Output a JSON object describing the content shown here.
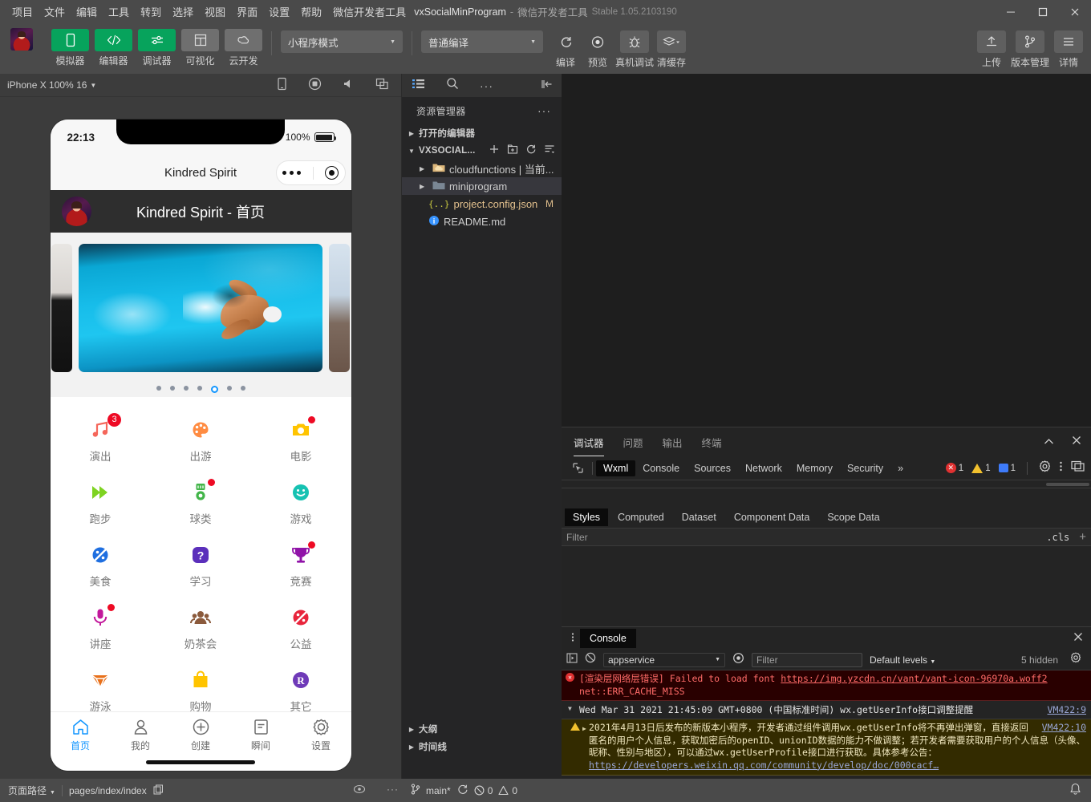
{
  "window": {
    "menus": [
      "项目",
      "文件",
      "编辑",
      "工具",
      "转到",
      "选择",
      "视图",
      "界面",
      "设置",
      "帮助",
      "微信开发者工具"
    ],
    "title_main": "vxSocialMinProgram",
    "title_sep": "-",
    "title_sub": "微信开发者工具",
    "title_version": "Stable 1.05.2103190",
    "minimize": "—",
    "maximize": "☐",
    "close": "✕"
  },
  "toolbar": {
    "tools": [
      {
        "label": "模拟器",
        "icon": "phone-icon",
        "style": "green"
      },
      {
        "label": "编辑器",
        "icon": "code-icon",
        "style": "green"
      },
      {
        "label": "调试器",
        "icon": "sliders-icon",
        "style": "green"
      },
      {
        "label": "可视化",
        "icon": "layout-icon",
        "style": "grey"
      },
      {
        "label": "云开发",
        "icon": "cloud-icon",
        "style": "grey"
      }
    ],
    "mode_select": "小程序模式",
    "compile_select": "普通编译",
    "actions": [
      {
        "label": "编译",
        "icon": "refresh-icon"
      },
      {
        "label": "预览",
        "icon": "eye-icon"
      },
      {
        "label": "真机调试",
        "icon": "bug-icon"
      },
      {
        "label": "清缓存",
        "icon": "layers-icon"
      }
    ],
    "right_actions": [
      {
        "label": "上传",
        "icon": "upload-icon"
      },
      {
        "label": "版本管理",
        "icon": "branch-icon"
      },
      {
        "label": "详情",
        "icon": "menu-icon"
      }
    ]
  },
  "simulator": {
    "device": "iPhone X 100% 16",
    "toolbar_icons": [
      "device-icon",
      "record-icon",
      "volume-icon",
      "windows-icon"
    ],
    "status_bar": {
      "time": "22:13",
      "battery_text": "100%"
    },
    "nav": {
      "title": "Kindred Spirit"
    },
    "page_header": {
      "title": "Kindred Spirit - 首页"
    },
    "carousel": {
      "dots_total": 7,
      "active_index": 4
    },
    "grid": [
      {
        "label": "演出",
        "icon": "music-icon",
        "color": "#f5665a",
        "badge": "3"
      },
      {
        "label": "出游",
        "icon": "palette-icon",
        "color": "#ff8c42",
        "badge": ""
      },
      {
        "label": "电影",
        "icon": "camera-icon",
        "color": "#ffc400",
        "badge": "dot"
      },
      {
        "label": "跑步",
        "icon": "fast-forward-icon",
        "color": "#7ed321",
        "badge": ""
      },
      {
        "label": "球类",
        "icon": "medal-icon",
        "color": "#42b549",
        "badge": "dot"
      },
      {
        "label": "游戏",
        "icon": "smile-icon",
        "color": "#16c2b2",
        "badge": ""
      },
      {
        "label": "美食",
        "icon": "planet-icon",
        "color": "#1f6fe0",
        "badge": ""
      },
      {
        "label": "学习",
        "icon": "question-icon",
        "color": "#5b2fbb",
        "badge": ""
      },
      {
        "label": "竞赛",
        "icon": "trophy-icon",
        "color": "#9013a8",
        "badge": "dot"
      },
      {
        "label": "讲座",
        "icon": "microphone-icon",
        "color": "#c2189b",
        "badge": "dot"
      },
      {
        "label": "奶茶会",
        "icon": "group-icon",
        "color": "#8b5a3c",
        "badge": ""
      },
      {
        "label": "公益",
        "icon": "planet-icon",
        "color": "#e8253c",
        "badge": ""
      },
      {
        "label": "游泳",
        "icon": "diamond-icon",
        "color": "#e8701a",
        "badge": ""
      },
      {
        "label": "购物",
        "icon": "bag-icon",
        "color": "#ffc400",
        "badge": ""
      },
      {
        "label": "其它",
        "icon": "registered-icon",
        "color": "#6f3ab8",
        "badge": ""
      }
    ],
    "tabbar": [
      {
        "label": "首页",
        "icon": "home-icon",
        "active": true
      },
      {
        "label": "我的",
        "icon": "user-icon",
        "active": false
      },
      {
        "label": "创建",
        "icon": "plus-circle-icon",
        "active": false
      },
      {
        "label": "瞬间",
        "icon": "note-icon",
        "active": false
      },
      {
        "label": "设置",
        "icon": "gear-icon",
        "active": false
      }
    ]
  },
  "explorer": {
    "actions": [
      "list-icon",
      "search-icon",
      "more-icon",
      "collapse-icon"
    ],
    "title": "资源管理器",
    "more": "···",
    "sections": [
      {
        "label": "打开的编辑器",
        "expanded": false
      },
      {
        "label": "VXSOCIAL...",
        "expanded": true
      }
    ],
    "files": [
      {
        "name": "cloudfunctions | 当前...",
        "type": "folder",
        "icon": "folder-cloud-icon",
        "mark": "",
        "selected": false
      },
      {
        "name": "miniprogram",
        "type": "folder",
        "icon": "folder-icon",
        "mark": "",
        "selected": true
      },
      {
        "name": "project.config.json",
        "type": "json",
        "icon": "json-icon",
        "mark": "M",
        "selected": false
      },
      {
        "name": "README.md",
        "type": "md",
        "icon": "info-icon",
        "mark": "",
        "selected": false
      }
    ],
    "bottom_sections": [
      "大纲",
      "时间线"
    ]
  },
  "devtools": {
    "panel_tabs": [
      {
        "label": "调试器",
        "active": true
      },
      {
        "label": "问题",
        "active": false
      },
      {
        "label": "输出",
        "active": false
      },
      {
        "label": "终端",
        "active": false
      }
    ],
    "panel_actions": [
      "chevron-up-icon",
      "close-icon"
    ],
    "inspector_tabs": [
      {
        "label": "Wxml",
        "active": true
      },
      {
        "label": "Console",
        "active": false
      },
      {
        "label": "Sources",
        "active": false
      },
      {
        "label": "Network",
        "active": false
      },
      {
        "label": "Memory",
        "active": false
      },
      {
        "label": "Security",
        "active": false
      }
    ],
    "overflow": "»",
    "counts": {
      "errors": "1",
      "warnings": "1",
      "info": "1"
    },
    "style_tabs": [
      {
        "label": "Styles",
        "active": true
      },
      {
        "label": "Computed",
        "active": false
      },
      {
        "label": "Dataset",
        "active": false
      },
      {
        "label": "Component Data",
        "active": false
      },
      {
        "label": "Scope Data",
        "active": false
      }
    ],
    "style_filter_placeholder": "Filter",
    "cls_label": ".cls",
    "plus": "+"
  },
  "console": {
    "tab": "Console",
    "context": "appservice",
    "filter_placeholder": "Filter",
    "levels": "Default levels",
    "hidden": "5 hidden",
    "messages": [
      {
        "type": "error",
        "prefix": "[渲染层网络层错误]",
        "text": " Failed to load font ",
        "link": "https://img.yzcdn.cn/vant/vant-icon-96970a.woff2",
        "line2": "net::ERR_CACHE_MISS"
      },
      {
        "type": "log",
        "text": "Wed Mar 31 2021 21:45:09 GMT+0800 (中国标准时间) wx.getUserInfo接口调整提醒",
        "source": "VM422:9"
      },
      {
        "type": "warning",
        "text": "2021年4月13日后发布的新版本小程序，开发者通过组件调用wx.getUserInfo将不再弹出弹窗，直接返回匿名的用户个人信息，获取加密后的openID、unionID数据的能力不做调整；若开发者需要获取用户的个人信息（头像、昵称、性别与地区），可以通过wx.getUserProfile接口进行获取。具体参考公告：",
        "link": "https://developers.weixin.qq.com/community/develop/doc/000cacf…",
        "source": "VM422:10"
      }
    ],
    "prompt": "›"
  },
  "statusbar": {
    "page_path_label": "页面路径",
    "page_path_value": "pages/index/index",
    "copy_icon": "copy-icon",
    "eye_icon": "eye-icon",
    "more_icon": "more-icon",
    "branch": "main*",
    "sync_icon": "sync-icon",
    "errors": "0",
    "warnings": "0",
    "bell_icon": "bell-icon"
  }
}
